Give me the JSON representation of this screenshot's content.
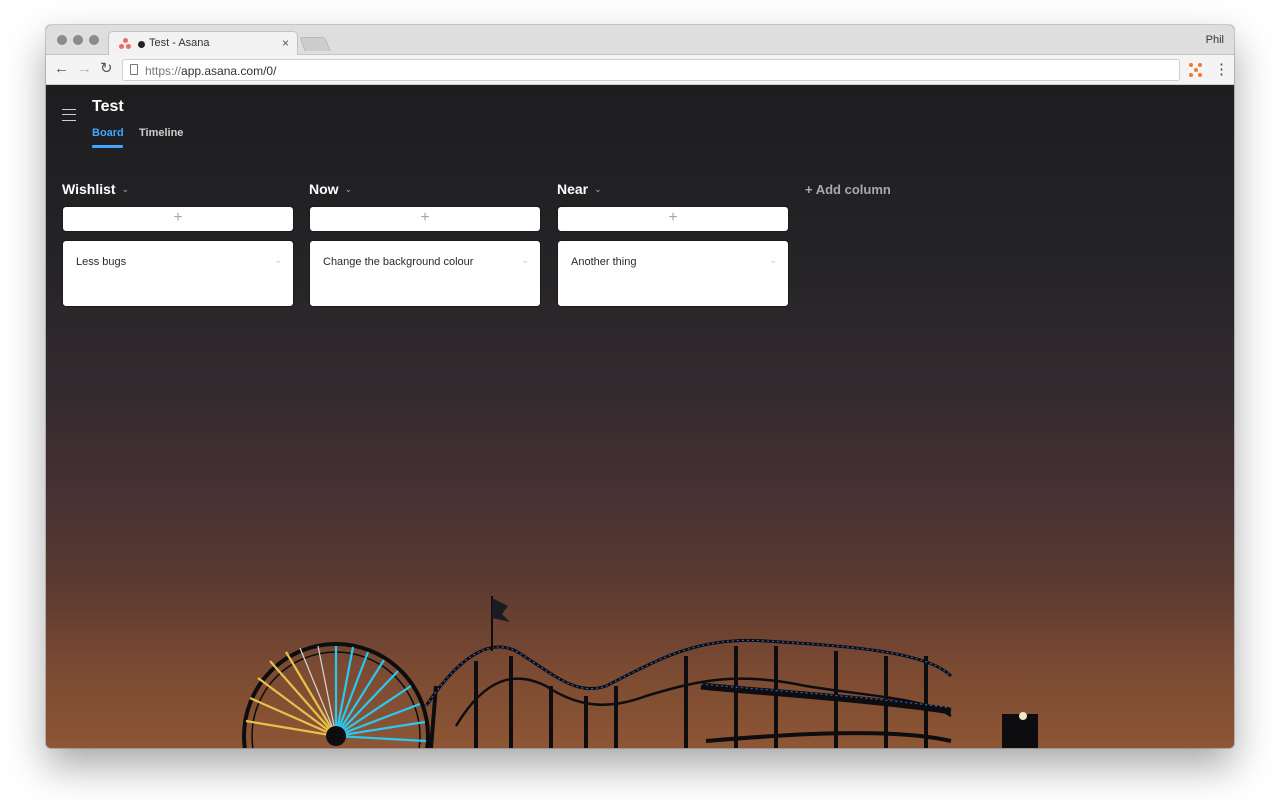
{
  "browser": {
    "tab_title": "Test - Asana",
    "tab_close": "×",
    "profile_name": "Phil",
    "url_prefix": "https://",
    "url_host": "app.asana.com/0/",
    "back_icon": "arrow-left-icon",
    "forward_icon": "arrow-right-icon",
    "reload_icon": "reload-icon",
    "menu_icon": "kebab-menu-icon"
  },
  "project": {
    "title": "Test",
    "tabs": [
      {
        "label": "Board",
        "active": true
      },
      {
        "label": "Timeline",
        "active": false
      }
    ]
  },
  "board": {
    "columns": [
      {
        "title": "Wishlist",
        "add_label": "+",
        "cards": [
          {
            "title": "Less bugs"
          }
        ]
      },
      {
        "title": "Now",
        "add_label": "+",
        "cards": [
          {
            "title": "Change the background colour"
          }
        ]
      },
      {
        "title": "Near",
        "add_label": "+",
        "cards": [
          {
            "title": "Another thing"
          }
        ]
      }
    ],
    "add_column_label": "+ Add column",
    "caret": "⌄"
  },
  "colors": {
    "accent": "#3fa7ff",
    "asana_coral": "#f06a6a",
    "ferris_cyan": "#29c9f2",
    "ferris_yellow": "#e6c24a"
  }
}
